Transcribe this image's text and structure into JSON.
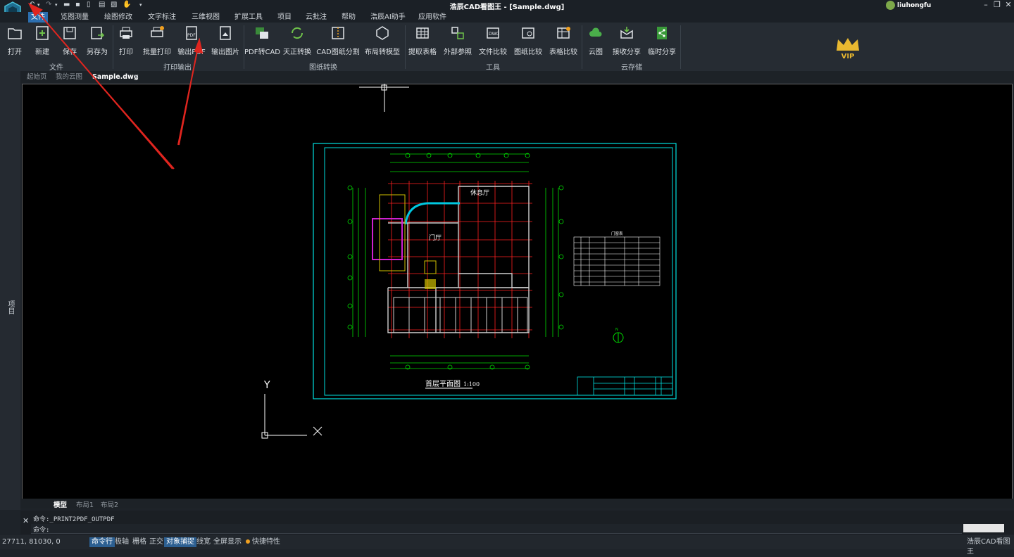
{
  "app": {
    "title": "浩辰CAD看图王 - [Sample.dwg]",
    "user": "liuhongfu"
  },
  "menu": [
    "文件",
    "览图测量",
    "绘图修改",
    "文字标注",
    "三维视图",
    "扩展工具",
    "项目",
    "云批注",
    "帮助",
    "浩辰AI助手",
    "应用软件"
  ],
  "ribbon": {
    "buttons": [
      "打开",
      "新建",
      "保存",
      "另存为",
      "打印",
      "批量打印",
      "输出PDF",
      "输出图片",
      "PDF转CAD",
      "天正转换",
      "CAD图纸分割",
      "布局转模型",
      "提取表格",
      "外部参照",
      "文件比较",
      "图纸比较",
      "表格比较",
      "云图",
      "接收分享",
      "临时分享"
    ],
    "groups": [
      "文件",
      "打印输出",
      "图纸转换",
      "工具",
      "云存储"
    ],
    "vip": "VIP"
  },
  "tabs": [
    "起始页",
    "我的云图",
    "Sample.dwg"
  ],
  "side_label": "项目",
  "drawing": {
    "title": "首层平面图",
    "scale": "1:100",
    "room1": "休息厅",
    "room2": "门厅",
    "table_title": "门窗表",
    "ucs_y": "Y",
    "ucs_x": "X"
  },
  "layout_tabs": [
    "模型",
    "布局1",
    "布局2"
  ],
  "command": {
    "history": "命令:_PRINT2PDF_OUTPDF",
    "prompt": "命令:"
  },
  "status": {
    "coords": "27711, 81030, 0",
    "toggles": [
      "命令行",
      "极轴",
      "栅格",
      "正交",
      "对象捕捉",
      "线宽",
      "全屏显示",
      "快捷特性"
    ],
    "app_name": "浩辰CAD看图王"
  },
  "colors": {
    "accent": "#2c6fb0",
    "canvas": "#000000",
    "frame": "#00e0e0",
    "grid": "#ff2020",
    "dim": "#00dd00",
    "annotation_arrow": "#e0251f"
  }
}
